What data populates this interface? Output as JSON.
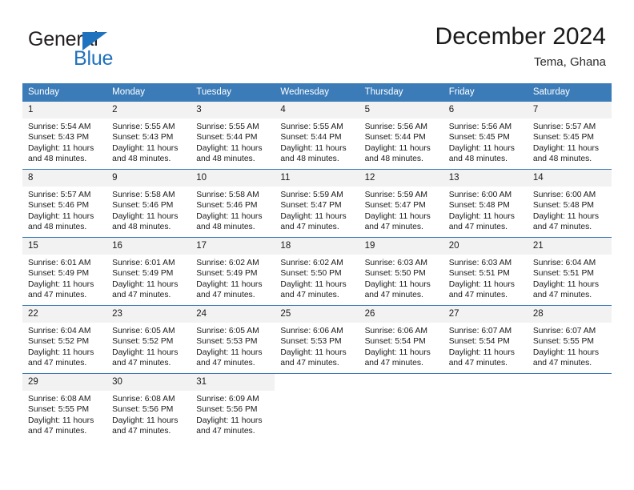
{
  "brand": {
    "name_part1": "General",
    "name_part2": "Blue",
    "accent_color": "#1f72bd",
    "triangle_icon": "triangle-icon"
  },
  "header": {
    "title": "December 2024",
    "location": "Tema, Ghana"
  },
  "calendar": {
    "header_bg": "#3b7cb8",
    "daynum_bg": "#f2f2f2",
    "weekdays": [
      "Sunday",
      "Monday",
      "Tuesday",
      "Wednesday",
      "Thursday",
      "Friday",
      "Saturday"
    ],
    "labels": {
      "sunrise": "Sunrise:",
      "sunset": "Sunset:",
      "daylight": "Daylight:"
    },
    "weeks": [
      [
        {
          "day": "1",
          "sunrise": "Sunrise: 5:54 AM",
          "sunset": "Sunset: 5:43 PM",
          "daylight": "Daylight: 11 hours and 48 minutes."
        },
        {
          "day": "2",
          "sunrise": "Sunrise: 5:55 AM",
          "sunset": "Sunset: 5:43 PM",
          "daylight": "Daylight: 11 hours and 48 minutes."
        },
        {
          "day": "3",
          "sunrise": "Sunrise: 5:55 AM",
          "sunset": "Sunset: 5:44 PM",
          "daylight": "Daylight: 11 hours and 48 minutes."
        },
        {
          "day": "4",
          "sunrise": "Sunrise: 5:55 AM",
          "sunset": "Sunset: 5:44 PM",
          "daylight": "Daylight: 11 hours and 48 minutes."
        },
        {
          "day": "5",
          "sunrise": "Sunrise: 5:56 AM",
          "sunset": "Sunset: 5:44 PM",
          "daylight": "Daylight: 11 hours and 48 minutes."
        },
        {
          "day": "6",
          "sunrise": "Sunrise: 5:56 AM",
          "sunset": "Sunset: 5:45 PM",
          "daylight": "Daylight: 11 hours and 48 minutes."
        },
        {
          "day": "7",
          "sunrise": "Sunrise: 5:57 AM",
          "sunset": "Sunset: 5:45 PM",
          "daylight": "Daylight: 11 hours and 48 minutes."
        }
      ],
      [
        {
          "day": "8",
          "sunrise": "Sunrise: 5:57 AM",
          "sunset": "Sunset: 5:46 PM",
          "daylight": "Daylight: 11 hours and 48 minutes."
        },
        {
          "day": "9",
          "sunrise": "Sunrise: 5:58 AM",
          "sunset": "Sunset: 5:46 PM",
          "daylight": "Daylight: 11 hours and 48 minutes."
        },
        {
          "day": "10",
          "sunrise": "Sunrise: 5:58 AM",
          "sunset": "Sunset: 5:46 PM",
          "daylight": "Daylight: 11 hours and 48 minutes."
        },
        {
          "day": "11",
          "sunrise": "Sunrise: 5:59 AM",
          "sunset": "Sunset: 5:47 PM",
          "daylight": "Daylight: 11 hours and 47 minutes."
        },
        {
          "day": "12",
          "sunrise": "Sunrise: 5:59 AM",
          "sunset": "Sunset: 5:47 PM",
          "daylight": "Daylight: 11 hours and 47 minutes."
        },
        {
          "day": "13",
          "sunrise": "Sunrise: 6:00 AM",
          "sunset": "Sunset: 5:48 PM",
          "daylight": "Daylight: 11 hours and 47 minutes."
        },
        {
          "day": "14",
          "sunrise": "Sunrise: 6:00 AM",
          "sunset": "Sunset: 5:48 PM",
          "daylight": "Daylight: 11 hours and 47 minutes."
        }
      ],
      [
        {
          "day": "15",
          "sunrise": "Sunrise: 6:01 AM",
          "sunset": "Sunset: 5:49 PM",
          "daylight": "Daylight: 11 hours and 47 minutes."
        },
        {
          "day": "16",
          "sunrise": "Sunrise: 6:01 AM",
          "sunset": "Sunset: 5:49 PM",
          "daylight": "Daylight: 11 hours and 47 minutes."
        },
        {
          "day": "17",
          "sunrise": "Sunrise: 6:02 AM",
          "sunset": "Sunset: 5:49 PM",
          "daylight": "Daylight: 11 hours and 47 minutes."
        },
        {
          "day": "18",
          "sunrise": "Sunrise: 6:02 AM",
          "sunset": "Sunset: 5:50 PM",
          "daylight": "Daylight: 11 hours and 47 minutes."
        },
        {
          "day": "19",
          "sunrise": "Sunrise: 6:03 AM",
          "sunset": "Sunset: 5:50 PM",
          "daylight": "Daylight: 11 hours and 47 minutes."
        },
        {
          "day": "20",
          "sunrise": "Sunrise: 6:03 AM",
          "sunset": "Sunset: 5:51 PM",
          "daylight": "Daylight: 11 hours and 47 minutes."
        },
        {
          "day": "21",
          "sunrise": "Sunrise: 6:04 AM",
          "sunset": "Sunset: 5:51 PM",
          "daylight": "Daylight: 11 hours and 47 minutes."
        }
      ],
      [
        {
          "day": "22",
          "sunrise": "Sunrise: 6:04 AM",
          "sunset": "Sunset: 5:52 PM",
          "daylight": "Daylight: 11 hours and 47 minutes."
        },
        {
          "day": "23",
          "sunrise": "Sunrise: 6:05 AM",
          "sunset": "Sunset: 5:52 PM",
          "daylight": "Daylight: 11 hours and 47 minutes."
        },
        {
          "day": "24",
          "sunrise": "Sunrise: 6:05 AM",
          "sunset": "Sunset: 5:53 PM",
          "daylight": "Daylight: 11 hours and 47 minutes."
        },
        {
          "day": "25",
          "sunrise": "Sunrise: 6:06 AM",
          "sunset": "Sunset: 5:53 PM",
          "daylight": "Daylight: 11 hours and 47 minutes."
        },
        {
          "day": "26",
          "sunrise": "Sunrise: 6:06 AM",
          "sunset": "Sunset: 5:54 PM",
          "daylight": "Daylight: 11 hours and 47 minutes."
        },
        {
          "day": "27",
          "sunrise": "Sunrise: 6:07 AM",
          "sunset": "Sunset: 5:54 PM",
          "daylight": "Daylight: 11 hours and 47 minutes."
        },
        {
          "day": "28",
          "sunrise": "Sunrise: 6:07 AM",
          "sunset": "Sunset: 5:55 PM",
          "daylight": "Daylight: 11 hours and 47 minutes."
        }
      ],
      [
        {
          "day": "29",
          "sunrise": "Sunrise: 6:08 AM",
          "sunset": "Sunset: 5:55 PM",
          "daylight": "Daylight: 11 hours and 47 minutes."
        },
        {
          "day": "30",
          "sunrise": "Sunrise: 6:08 AM",
          "sunset": "Sunset: 5:56 PM",
          "daylight": "Daylight: 11 hours and 47 minutes."
        },
        {
          "day": "31",
          "sunrise": "Sunrise: 6:09 AM",
          "sunset": "Sunset: 5:56 PM",
          "daylight": "Daylight: 11 hours and 47 minutes."
        },
        {
          "day": "",
          "sunrise": "",
          "sunset": "",
          "daylight": ""
        },
        {
          "day": "",
          "sunrise": "",
          "sunset": "",
          "daylight": ""
        },
        {
          "day": "",
          "sunrise": "",
          "sunset": "",
          "daylight": ""
        },
        {
          "day": "",
          "sunrise": "",
          "sunset": "",
          "daylight": ""
        }
      ]
    ]
  }
}
